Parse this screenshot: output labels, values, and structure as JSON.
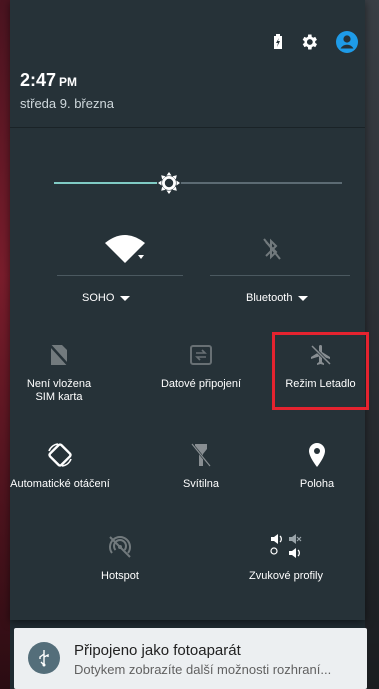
{
  "status": {
    "time": "2:47",
    "ampm": "PM",
    "date": "středa 9. března"
  },
  "brightness": {
    "level": 0.4
  },
  "big_tiles": [
    {
      "label": "SOHO"
    },
    {
      "label": "Bluetooth"
    }
  ],
  "tiles": [
    {
      "label": "Není vložena SIM karta"
    },
    {
      "label": "Datové připojení"
    },
    {
      "label": "Režim Letadlo"
    },
    {
      "label": "Automatické otáčení"
    },
    {
      "label": "Svítilna"
    },
    {
      "label": "Poloha"
    },
    {
      "label": "Hotspot"
    },
    {
      "label": "Zvukové profily"
    }
  ],
  "notification": {
    "title": "Připojeno jako fotoaparát",
    "text": "Dotykem zobrazíte další možnosti rozhraní..."
  },
  "colors": {
    "accent": "#80cbc4",
    "highlight": "#e5232f",
    "panel": "#263238",
    "user_icon": "#1e9be8"
  }
}
